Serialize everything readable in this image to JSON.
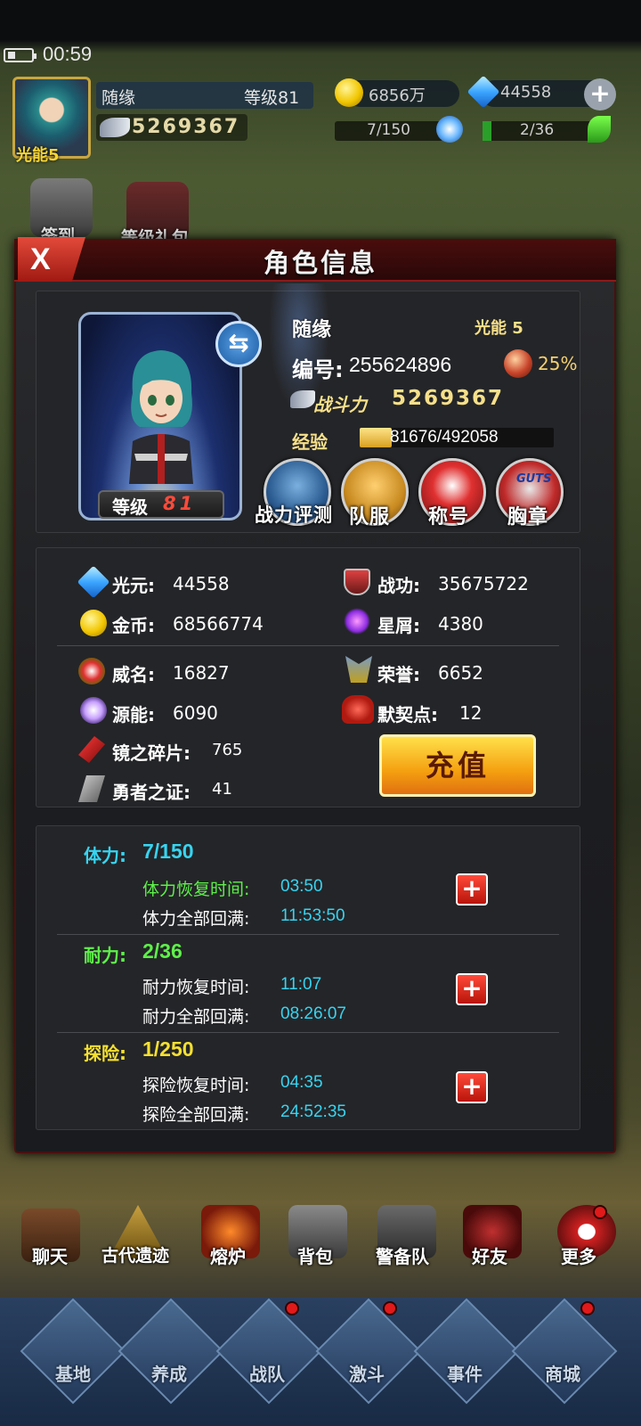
{
  "status": {
    "time": "00:59"
  },
  "player": {
    "name": "随缘",
    "level": "等级81",
    "light_energy": "光能5",
    "power": "5269367"
  },
  "top_resources": {
    "gold": "6856万",
    "crystals": "44558",
    "stamina": "7/150",
    "endurance": "2/36"
  },
  "side_buttons": {
    "signin": "签到",
    "level_gift": "等级礼包"
  },
  "dialog": {
    "title": "角色信息",
    "close": "X"
  },
  "profile": {
    "name": "随缘",
    "light_label": "光能 5",
    "id_label": "编号:",
    "id_value": "255624896",
    "pct": "25%",
    "power_label": "战斗力",
    "power_value": "5269367",
    "exp_label": "经验",
    "exp_value": "81676/492058",
    "exp_fraction": 0.166,
    "level_label": "等级",
    "level_value": "81",
    "actions": [
      "战力评测",
      "队服",
      "称号",
      "胸章"
    ],
    "badge_text": "GUTS"
  },
  "resources": {
    "guangyuan": {
      "label": "光元:",
      "value": "44558"
    },
    "zhangong": {
      "label": "战功:",
      "value": "35675722"
    },
    "jinbi": {
      "label": "金币:",
      "value": "68566774"
    },
    "xingxie": {
      "label": "星屑:",
      "value": "4380"
    },
    "weiming": {
      "label": "威名:",
      "value": "16827"
    },
    "rongyu": {
      "label": "荣誉:",
      "value": "6652"
    },
    "yuanneng": {
      "label": "源能:",
      "value": "6090"
    },
    "moqidian": {
      "label": "默契点:",
      "value": "12"
    },
    "jingzhi": {
      "label": "镜之碎片:",
      "value": "765"
    },
    "yongzhe": {
      "label": "勇者之证:",
      "value": "41"
    },
    "recharge": "充值"
  },
  "stamina": {
    "tili": {
      "label": "体力:",
      "value": "7/150",
      "recover_label": "体力恢复时间:",
      "recover_value": "03:50",
      "full_label": "体力全部回满:",
      "full_value": "11:53:50"
    },
    "naili": {
      "label": "耐力:",
      "value": "2/36",
      "recover_label": "耐力恢复时间:",
      "recover_value": "11:07",
      "full_label": "耐力全部回满:",
      "full_value": "08:26:07"
    },
    "tanxian": {
      "label": "探险:",
      "value": "1/250",
      "recover_label": "探险恢复时间:",
      "recover_value": "04:35",
      "full_label": "探险全部回满:",
      "full_value": "24:52:35"
    }
  },
  "bottom_menu": [
    "聊天",
    "古代遗迹",
    "熔炉",
    "背包",
    "警备队",
    "好友",
    "更多"
  ],
  "nav": [
    "基地",
    "养成",
    "战队",
    "激斗",
    "事件",
    "商城"
  ],
  "colors": {
    "accent_gold": "#f7e08a",
    "cyan": "#37d4f0",
    "green": "#5ef04a",
    "red": "#e01a1a"
  }
}
